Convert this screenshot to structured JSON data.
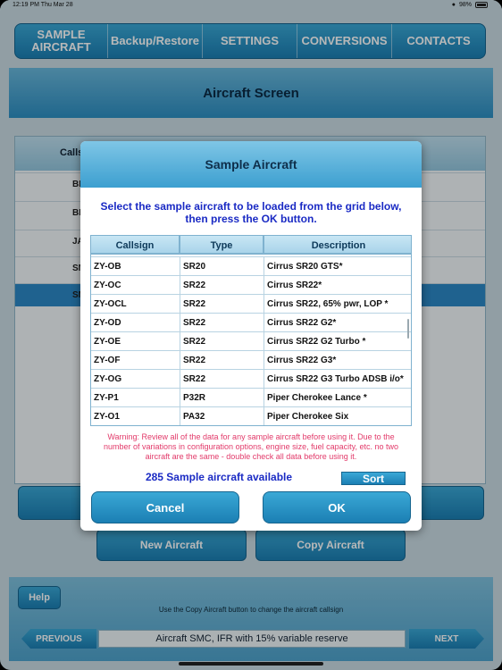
{
  "status_bar": {
    "time": "12:19 PM",
    "date": "Thu Mar 28",
    "battery": "98%"
  },
  "top_nav": [
    {
      "label": "SAMPLE AIRCRAFT"
    },
    {
      "label": "Backup/Restore"
    },
    {
      "label": "SETTINGS"
    },
    {
      "label": "CONVERSIONS"
    },
    {
      "label": "CONTACTS"
    }
  ],
  "screen_title": "Aircraft Screen",
  "background": {
    "grid_header_fragment": "Calls",
    "row_fragments": [
      "BI",
      "BI",
      "JA",
      "SM",
      "SM"
    ],
    "new_aircraft_label": "New Aircraft",
    "copy_aircraft_label": "Copy Aircraft"
  },
  "modal": {
    "title": "Sample Aircraft",
    "instructions": "Select the sample aircraft to be loaded from the grid below, then press the OK button.",
    "columns": [
      "Callsign",
      "Type",
      "Description"
    ],
    "rows": [
      {
        "callsign": "ZY-OB",
        "type": "SR20",
        "description": "Cirrus SR20 GTS*"
      },
      {
        "callsign": "ZY-OC",
        "type": "SR22",
        "description": "Cirrus SR22*"
      },
      {
        "callsign": "ZY-OCL",
        "type": "SR22",
        "description": "Cirrus SR22, 65% pwr, LOP *"
      },
      {
        "callsign": "ZY-OD",
        "type": "SR22",
        "description": "Cirrus SR22 G2*"
      },
      {
        "callsign": "ZY-OE",
        "type": "SR22",
        "description": "Cirrus SR22 G2 Turbo *"
      },
      {
        "callsign": "ZY-OF",
        "type": "SR22",
        "description": "Cirrus SR22 G3*"
      },
      {
        "callsign": "ZY-OG",
        "type": "SR22",
        "description": "Cirrus SR22 G3 Turbo ADSB i/o*"
      },
      {
        "callsign": "ZY-P1",
        "type": "P32R",
        "description": "Piper Cherokee Lance *"
      },
      {
        "callsign": "ZY-O1",
        "type": "PA32",
        "description": "Piper Cherokee Six"
      }
    ],
    "warning": "Warning: Review all of the data for any sample aircraft before using it. Due to the number of variations in configuration options, engine size, fuel capacity, etc. no two aircraft are the same - double check all data before using it.",
    "available_count": "285 Sample aircraft available",
    "sort_label": "Sort",
    "cancel_label": "Cancel",
    "ok_label": "OK"
  },
  "footer": {
    "help_label": "Help",
    "hint": "Use the Copy Aircraft button to change the aircraft callsign",
    "previous_label": "PREVIOUS",
    "next_label": "NEXT",
    "current_aircraft": "Aircraft SMC, IFR with 15% variable reserve"
  }
}
